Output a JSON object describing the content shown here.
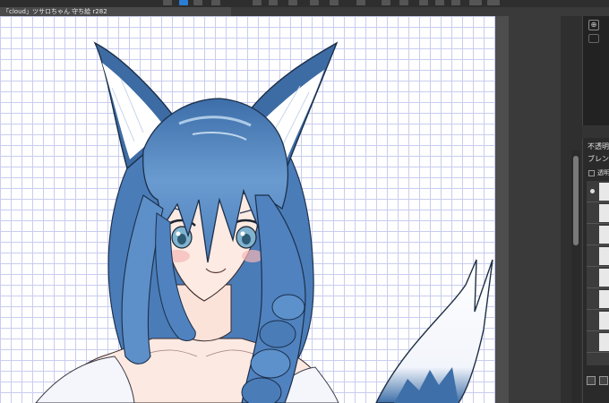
{
  "document": {
    "tab_title": "「cloud」ツサロちゃん 守ち絵 r282"
  },
  "layer_panel": {
    "opacity_label": "不透明",
    "blend_label": "ブレンド",
    "check_label": "透明"
  },
  "icons": {
    "zoom": "zoom-icon",
    "new_layer": "new-layer-icon",
    "copy_layer": "copy-layer-icon",
    "visibility": "eye-icon"
  },
  "colors": {
    "accent": "#2a7fd4",
    "canvas_grid": "#c9cdef",
    "hair": "#4f7fb8",
    "hair_dark": "#2e5a8f"
  }
}
